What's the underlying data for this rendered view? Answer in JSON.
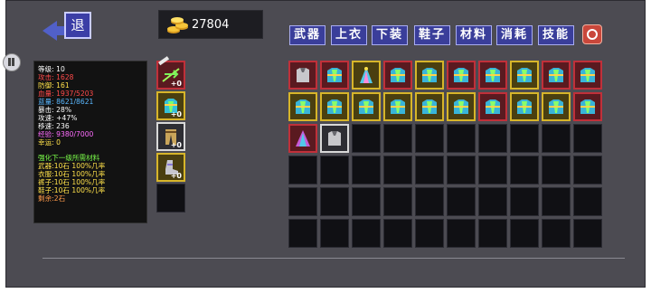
{
  "back_button": {
    "label": "退"
  },
  "gold": {
    "value": "27804"
  },
  "tabs": [
    "武器",
    "上衣",
    "下装",
    "鞋子",
    "材料",
    "消耗",
    "技能"
  ],
  "stats": {
    "level": "等级: 10",
    "attack": "攻击: 1628",
    "defense": "防御: 161",
    "hp": "血量: 1937/5203",
    "mp": "蓝量: 8621/8621",
    "crit": "暴击: 28%",
    "speed": "攻速: +47%",
    "move": "移速: 236",
    "exp": "经验: 9380/7000",
    "luck": "幸运: 0",
    "upgrade_title": "强化下一级所需材料",
    "weapon_cost": "武器:10石 100%几率",
    "armor_cost": "衣服:10石 100%几率",
    "pants_cost": "裤子:10石 100%几率",
    "shoes_cost": "鞋子:10石 100%几率",
    "remaining": "剩余:2石"
  },
  "colors": {
    "white": "#ffffff",
    "red": "#ff4a4a",
    "blue": "#5ab8ff",
    "magenta": "#ff6cff",
    "yellow": "#ffe14a",
    "green": "#7cff4a"
  },
  "equipped_plus": "+0"
}
